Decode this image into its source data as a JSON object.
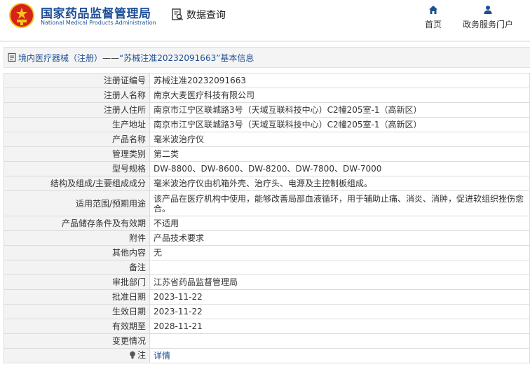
{
  "header": {
    "title_cn": "国家药品监督管理局",
    "title_en": "National Medical Products Administration",
    "data_query_label": "数据查询",
    "nav": [
      {
        "label": "首页",
        "icon": "home-icon"
      },
      {
        "label": "政务服务门户",
        "icon": "user-icon"
      }
    ]
  },
  "breadcrumb": {
    "section": "境内医疗器械（注册）",
    "separator": "——",
    "record": "“苏械注准20232091663”基本信息"
  },
  "table": {
    "rows": [
      {
        "label": "注册证编号",
        "value": "苏械注准20232091663"
      },
      {
        "label": "注册人名称",
        "value": "南京大麦医疗科技有限公司"
      },
      {
        "label": "注册人住所",
        "value": "南京市江宁区联城路3号（天域互联科技中心）C2幢205室-1（高新区）"
      },
      {
        "label": "生产地址",
        "value": "南京市江宁区联城路3号（天域互联科技中心）C2幢205室-1（高新区）"
      },
      {
        "label": "产品名称",
        "value": "毫米波治疗仪"
      },
      {
        "label": "管理类别",
        "value": "第二类"
      },
      {
        "label": "型号规格",
        "value": "DW-8800、DW-8600、DW-8200、DW-7800、DW-7000"
      },
      {
        "label": "结构及组成/主要组成成分",
        "value": "毫米波治疗仪由机箱外壳、治疗头、电源及主控制板组成。"
      },
      {
        "label": "适用范围/预期用途",
        "value": "该产品在医疗机构中使用，能够改善局部血液循环，用于辅助止痛、消炎、消肿，促进软组织挫伤愈合。"
      },
      {
        "label": "产品储存条件及有效期",
        "value": "不适用"
      },
      {
        "label": "附件",
        "value": "产品技术要求"
      },
      {
        "label": "其他内容",
        "value": "无"
      },
      {
        "label": "备注",
        "value": ""
      },
      {
        "label": "审批部门",
        "value": "江苏省药品监督管理局"
      },
      {
        "label": "批准日期",
        "value": "2023-11-22"
      },
      {
        "label": "生效日期",
        "value": "2023-11-22"
      },
      {
        "label": "有效期至",
        "value": "2028-11-21"
      },
      {
        "label": "变更情况",
        "value": ""
      }
    ],
    "note_label": "注",
    "note_link": "详情"
  },
  "colors": {
    "brand_blue": "#1d4f96",
    "emblem_red": "#d6221b",
    "emblem_gold": "#f5c518",
    "label_bg": "#f3f3f3",
    "border": "#dcdcdc"
  }
}
